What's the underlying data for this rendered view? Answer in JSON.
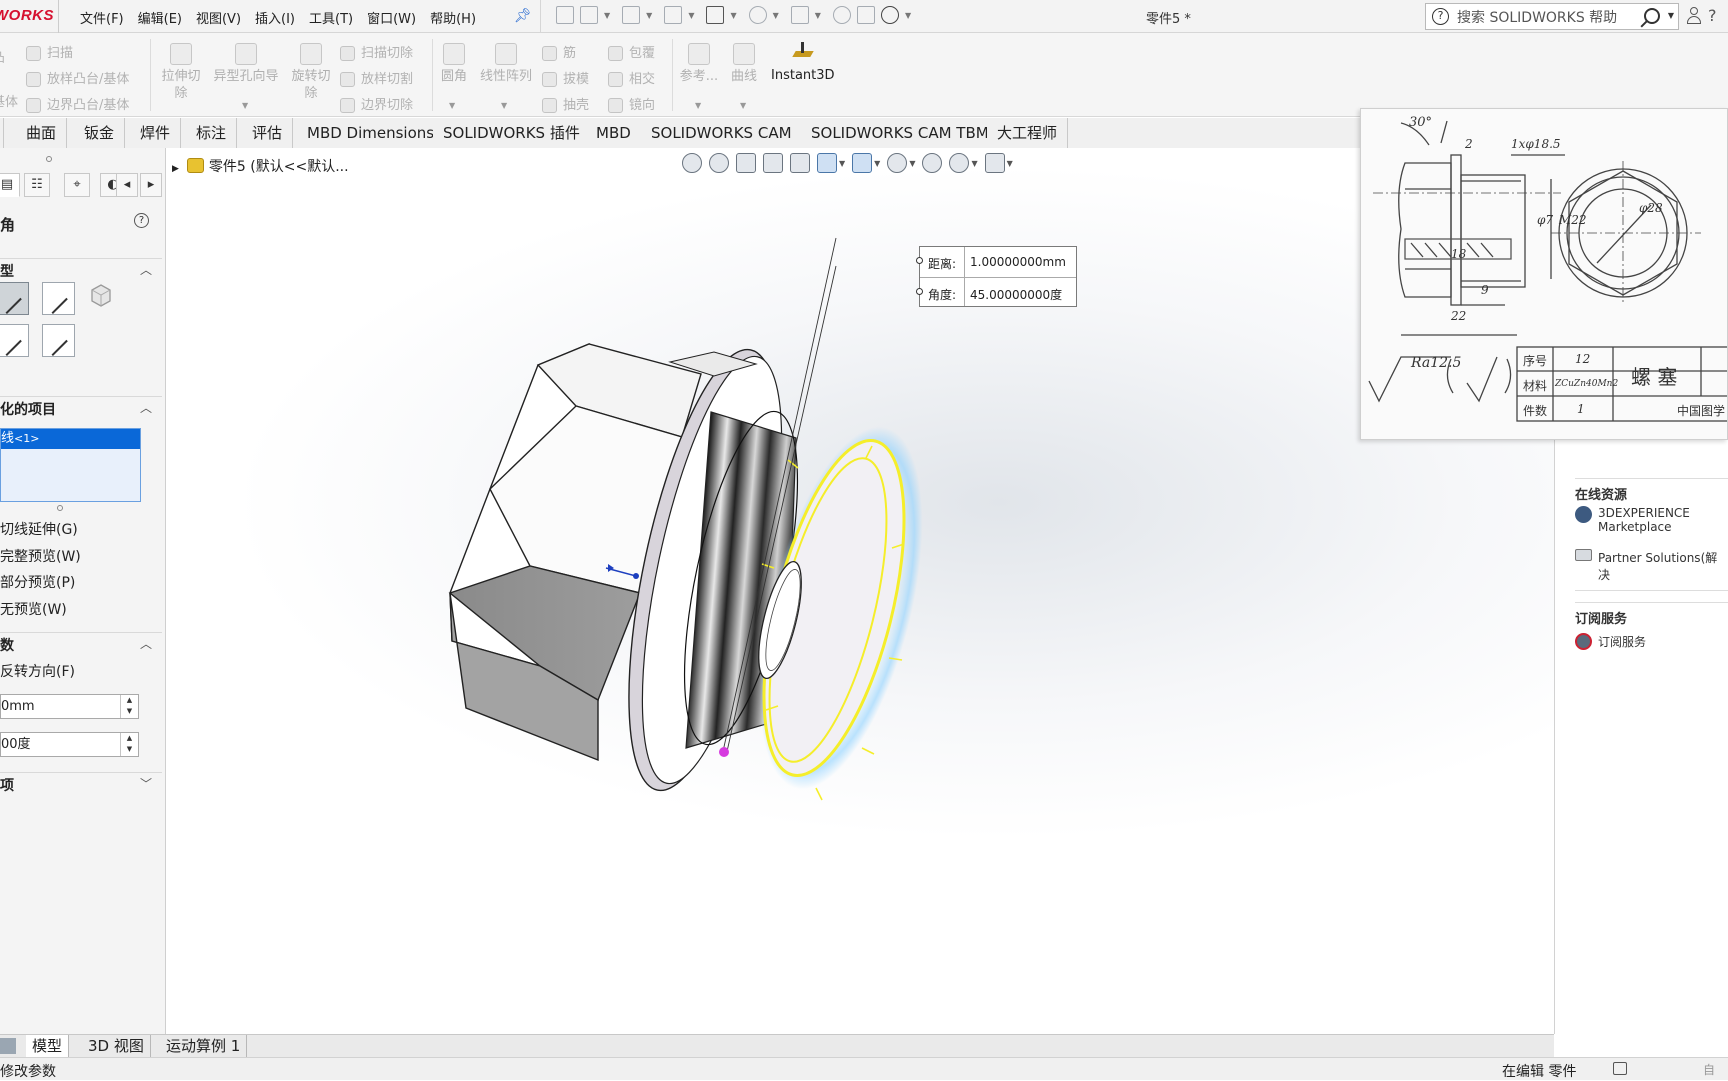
{
  "app": {
    "logo": "WORKS",
    "document_title": "零件5 *"
  },
  "menu": [
    "文件(F)",
    "编辑(E)",
    "视图(V)",
    "插入(I)",
    "工具(T)",
    "窗口(W)",
    "帮助(H)"
  ],
  "search": {
    "placeholder": "搜索 SOLIDWORKS 帮助"
  },
  "ribbon": {
    "sweep": "扫描",
    "loft": "放样凸台/基体",
    "boundary": "边界凸台/基体",
    "boss_partial": "凸",
    "boss_partial2": "基体",
    "extrude_cut": [
      "拉伸切",
      "除"
    ],
    "hole_wizard": "异型孔向导",
    "revolve_cut": [
      "旋转切",
      "除"
    ],
    "sweep_cut": "扫描切除",
    "loft_cut": "放样切割",
    "boundary_cut": "边界切除",
    "fillet": "圆角",
    "linear_pattern": "线性阵列",
    "rib": "筋",
    "draft": "拔模",
    "shell": "抽壳",
    "wrap": "包覆",
    "intersect": "相交",
    "mirror": "镜向",
    "reference": "参考...",
    "curves": "曲线",
    "instant3d": "Instant3D"
  },
  "tabs": [
    "曲面",
    "钣金",
    "焊件",
    "标注",
    "评估",
    "MBD Dimensions",
    "SOLIDWORKS 插件",
    "MBD",
    "SOLIDWORKS CAM",
    "SOLIDWORKS CAM TBM",
    "大工程师"
  ],
  "property_manager": {
    "title": "角",
    "section_type": "型",
    "section_items": "化的项目",
    "selected_item": "线",
    "selected_item_sub": "<1>",
    "tangent_propagation": "切线延伸(G)",
    "full_preview": "完整预览(W)",
    "partial_preview": "部分预览(P)",
    "no_preview": "无预览(W)",
    "section_params": "数",
    "reverse_direction": "反转方向(F)",
    "distance_value": "0mm",
    "angle_value": "00度",
    "section_options": "项"
  },
  "viewport": {
    "tree_node": "零件5 (默认<<默认..."
  },
  "callout": {
    "distance_label": "距离:",
    "distance_value": "1.00000000mm",
    "angle_label": "角度:",
    "angle_value": "45.00000000度"
  },
  "drawing": {
    "angle": "30°",
    "chamfer": "1xφ18.5",
    "dim_2": "2",
    "dim_18": "18",
    "dim_9": "9",
    "dim_22": "22",
    "dim_m22": "M22",
    "dim_phi7": "φ7",
    "dim_phi28": "φ28",
    "roughness": "Ra12.5",
    "tb_no_label": "序号",
    "tb_no_value": "12",
    "tb_material_label": "材料",
    "tb_material_value": "ZCuZn40Mn2",
    "tb_qty_label": "件数",
    "tb_qty_value": "1",
    "tb_name": "螺 塞",
    "tb_org": "中国图学"
  },
  "task_pane": {
    "online_resources": "在线资源",
    "marketplace_line1": "3DEXPERIENCE",
    "marketplace_line2": "Marketplace",
    "partner_solutions": "Partner Solutions(解决",
    "subscription_header": "订阅服务",
    "subscription_item": "订阅服务"
  },
  "bottom_tabs": [
    "模型",
    "3D 视图",
    "运动算例 1"
  ],
  "status": {
    "left": "修改参数",
    "right": "在编辑 零件",
    "far_right": "自"
  },
  "colors": {
    "accent_blue": "#0a68d8",
    "edge_selection_yellow": "#f5ee2a",
    "logo_red": "#d6102f"
  }
}
